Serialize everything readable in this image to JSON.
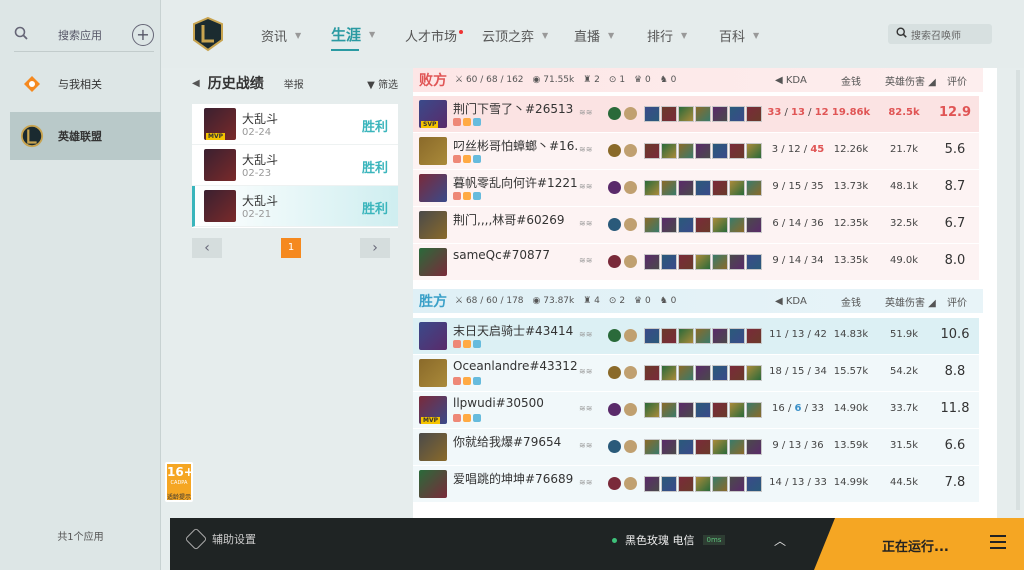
{
  "sidebar": {
    "search_placeholder": "搜索应用",
    "items": [
      {
        "label": "与我相关"
      },
      {
        "label": "英雄联盟"
      }
    ],
    "footer": "共1个应用",
    "age_rating": {
      "number": "16+",
      "small": "CADPA",
      "caption": "适龄提示"
    }
  },
  "nav": {
    "items": [
      {
        "label": "资讯"
      },
      {
        "label": "生涯"
      },
      {
        "label": "人才市场"
      },
      {
        "label": "云顶之弈"
      },
      {
        "label": "直播"
      },
      {
        "label": "排行"
      },
      {
        "label": "百科"
      }
    ],
    "summoner_search_placeholder": "搜索召唤师"
  },
  "history": {
    "title": "历史战绩",
    "report": "举报",
    "filter": "筛选",
    "matches": [
      {
        "mode": "大乱斗",
        "date": "02-24",
        "result": "胜利",
        "badge": "MVP"
      },
      {
        "mode": "大乱斗",
        "date": "02-23",
        "result": "胜利"
      },
      {
        "mode": "大乱斗",
        "date": "02-21",
        "result": "胜利"
      }
    ],
    "current_page": "1"
  },
  "columns": {
    "kda": "KDA",
    "gold": "金钱",
    "damage": "英雄伤害",
    "score": "评价"
  },
  "teams": {
    "lose": {
      "label": "败方",
      "stats": {
        "kda": "60 / 68 / 162",
        "gold": "71.55k",
        "towers": "2",
        "inhib": "1",
        "baron": "0",
        "dragon": "0"
      },
      "players": [
        {
          "name": "荆门下雪了丶#26513",
          "kda_k": "33",
          "kda_d": "13",
          "kda_a": "12",
          "gold": "19.86k",
          "damage": "82.5k",
          "score": "12.9",
          "badge": "SVP"
        },
        {
          "name": "叼丝彬哥怕蟑螂丶#16...",
          "kda_k": "3",
          "kda_d": "12",
          "kda_a": "45",
          "gold": "12.26k",
          "damage": "21.7k",
          "score": "5.6"
        },
        {
          "name": "暮帆零乱向何许#12217",
          "kda_k": "9",
          "kda_d": "15",
          "kda_a": "35",
          "gold": "13.73k",
          "damage": "48.1k",
          "score": "8.7"
        },
        {
          "name": "荆门,,,,林哥#60269",
          "kda_k": "6",
          "kda_d": "14",
          "kda_a": "36",
          "gold": "12.35k",
          "damage": "32.5k",
          "score": "6.7"
        },
        {
          "name": "sameQc#70877",
          "kda_k": "9",
          "kda_d": "14",
          "kda_a": "34",
          "gold": "13.35k",
          "damage": "49.0k",
          "score": "8.0"
        }
      ]
    },
    "win": {
      "label": "胜方",
      "stats": {
        "kda": "68 / 60 / 178",
        "gold": "73.87k",
        "towers": "4",
        "inhib": "2",
        "baron": "0",
        "dragon": "0"
      },
      "players": [
        {
          "name": "末日天启骑士#43414",
          "kda_k": "11",
          "kda_d": "13",
          "kda_a": "42",
          "gold": "14.83k",
          "damage": "51.9k",
          "score": "10.6"
        },
        {
          "name": "Oceanlandre#43312",
          "kda_k": "18",
          "kda_d": "15",
          "kda_a": "34",
          "gold": "15.57k",
          "damage": "54.2k",
          "score": "8.8"
        },
        {
          "name": "llpwudi#30500",
          "kda_k": "16",
          "kda_d": "6",
          "kda_a": "33",
          "gold": "14.90k",
          "damage": "33.7k",
          "score": "11.8",
          "badge": "MVP"
        },
        {
          "name": "你就给我爆#79654",
          "kda_k": "9",
          "kda_d": "13",
          "kda_a": "36",
          "gold": "13.59k",
          "damage": "31.5k",
          "score": "6.6"
        },
        {
          "name": "爱唱跳的坤坤#76689",
          "kda_k": "14",
          "kda_d": "13",
          "kda_a": "33",
          "gold": "14.99k",
          "damage": "44.5k",
          "score": "7.8"
        }
      ]
    }
  },
  "bottombar": {
    "assist": "辅助设置",
    "server": "黑色玫瑰 电信",
    "ping": "0ms",
    "running": "正在运行..."
  },
  "colors": {
    "accent": "#2a9aa2",
    "lose": "#e05555",
    "win": "#3aa0c8",
    "orange": "#f5a623"
  }
}
